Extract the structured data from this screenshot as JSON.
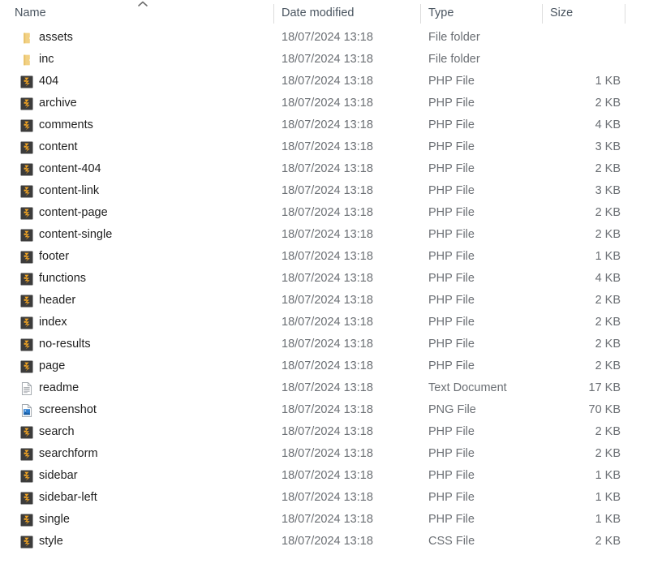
{
  "window": {
    "view": "Details",
    "sort_column": "Name",
    "sort_direction": "ascending"
  },
  "columns": {
    "name": "Name",
    "date_modified": "Date modified",
    "type": "Type",
    "size": "Size"
  },
  "colors": {
    "folder": "#f2d184",
    "folder_dark": "#e8c268",
    "php_badge_bg": "#3c3c3c",
    "php_glyph": "#f5a623",
    "text_primary": "#1f1f1f",
    "text_secondary": "#6b6f74",
    "header_text": "#4a5560",
    "divider": "#dcdcdc",
    "background": "#ffffff",
    "png_thumb": "#2f7fd0"
  },
  "files": [
    {
      "name": "assets",
      "date": "18/07/2024 13:18",
      "type": "File folder",
      "size": "",
      "icon": "folder-icon"
    },
    {
      "name": "inc",
      "date": "18/07/2024 13:18",
      "type": "File folder",
      "size": "",
      "icon": "folder-icon"
    },
    {
      "name": "404",
      "date": "18/07/2024 13:18",
      "type": "PHP File",
      "size": "1 KB",
      "icon": "php-file-icon"
    },
    {
      "name": "archive",
      "date": "18/07/2024 13:18",
      "type": "PHP File",
      "size": "2 KB",
      "icon": "php-file-icon"
    },
    {
      "name": "comments",
      "date": "18/07/2024 13:18",
      "type": "PHP File",
      "size": "4 KB",
      "icon": "php-file-icon"
    },
    {
      "name": "content",
      "date": "18/07/2024 13:18",
      "type": "PHP File",
      "size": "3 KB",
      "icon": "php-file-icon"
    },
    {
      "name": "content-404",
      "date": "18/07/2024 13:18",
      "type": "PHP File",
      "size": "2 KB",
      "icon": "php-file-icon"
    },
    {
      "name": "content-link",
      "date": "18/07/2024 13:18",
      "type": "PHP File",
      "size": "3 KB",
      "icon": "php-file-icon"
    },
    {
      "name": "content-page",
      "date": "18/07/2024 13:18",
      "type": "PHP File",
      "size": "2 KB",
      "icon": "php-file-icon"
    },
    {
      "name": "content-single",
      "date": "18/07/2024 13:18",
      "type": "PHP File",
      "size": "2 KB",
      "icon": "php-file-icon"
    },
    {
      "name": "footer",
      "date": "18/07/2024 13:18",
      "type": "PHP File",
      "size": "1 KB",
      "icon": "php-file-icon"
    },
    {
      "name": "functions",
      "date": "18/07/2024 13:18",
      "type": "PHP File",
      "size": "4 KB",
      "icon": "php-file-icon"
    },
    {
      "name": "header",
      "date": "18/07/2024 13:18",
      "type": "PHP File",
      "size": "2 KB",
      "icon": "php-file-icon"
    },
    {
      "name": "index",
      "date": "18/07/2024 13:18",
      "type": "PHP File",
      "size": "2 KB",
      "icon": "php-file-icon"
    },
    {
      "name": "no-results",
      "date": "18/07/2024 13:18",
      "type": "PHP File",
      "size": "2 KB",
      "icon": "php-file-icon"
    },
    {
      "name": "page",
      "date": "18/07/2024 13:18",
      "type": "PHP File",
      "size": "2 KB",
      "icon": "php-file-icon"
    },
    {
      "name": "readme",
      "date": "18/07/2024 13:18",
      "type": "Text Document",
      "size": "17 KB",
      "icon": "text-document-icon"
    },
    {
      "name": "screenshot",
      "date": "18/07/2024 13:18",
      "type": "PNG File",
      "size": "70 KB",
      "icon": "png-image-icon"
    },
    {
      "name": "search",
      "date": "18/07/2024 13:18",
      "type": "PHP File",
      "size": "2 KB",
      "icon": "php-file-icon"
    },
    {
      "name": "searchform",
      "date": "18/07/2024 13:18",
      "type": "PHP File",
      "size": "2 KB",
      "icon": "php-file-icon"
    },
    {
      "name": "sidebar",
      "date": "18/07/2024 13:18",
      "type": "PHP File",
      "size": "1 KB",
      "icon": "php-file-icon"
    },
    {
      "name": "sidebar-left",
      "date": "18/07/2024 13:18",
      "type": "PHP File",
      "size": "1 KB",
      "icon": "php-file-icon"
    },
    {
      "name": "single",
      "date": "18/07/2024 13:18",
      "type": "PHP File",
      "size": "1 KB",
      "icon": "php-file-icon"
    },
    {
      "name": "style",
      "date": "18/07/2024 13:18",
      "type": "CSS File",
      "size": "2 KB",
      "icon": "php-file-icon"
    }
  ]
}
